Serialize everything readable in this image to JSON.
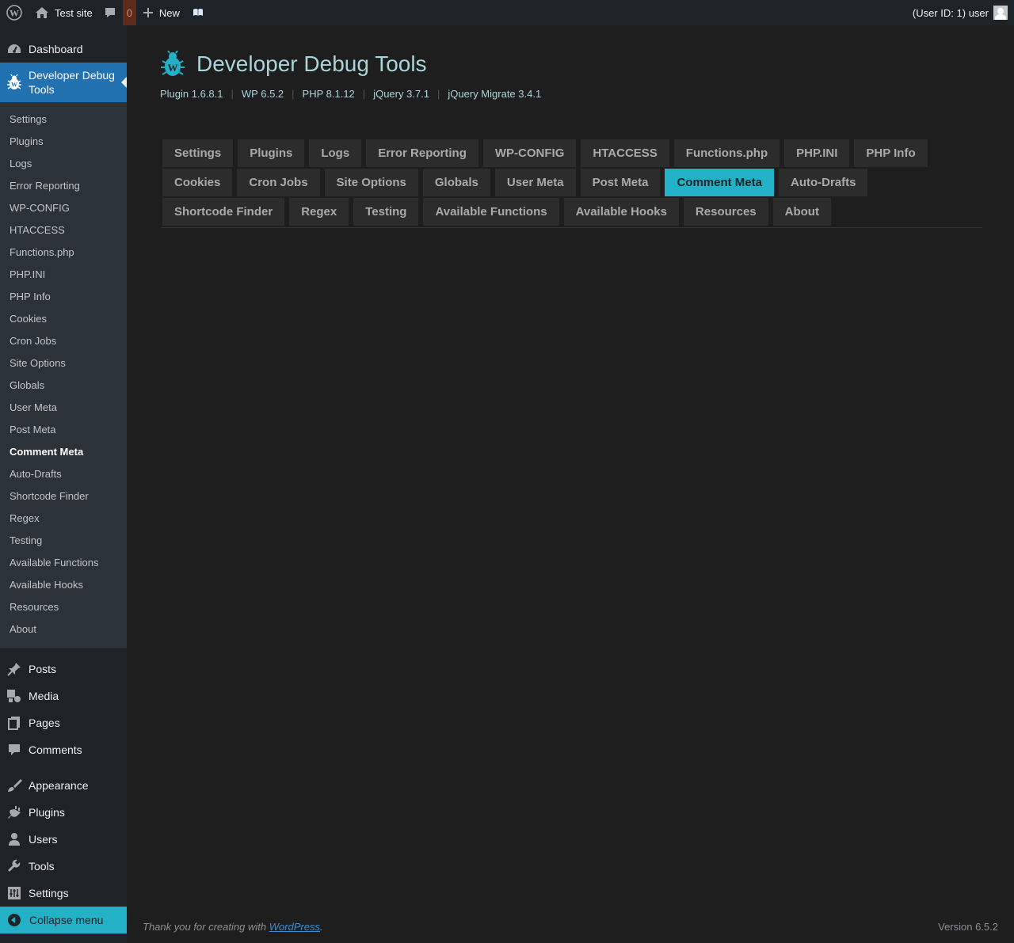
{
  "admin_bar": {
    "site_name": "Test site",
    "comment_count": "0",
    "new_label": "New",
    "user_label": "(User ID: 1) user"
  },
  "sidebar": {
    "top_before": [
      {
        "label": "Dashboard",
        "icon": "dashboard-icon"
      }
    ],
    "current": {
      "label": "Developer Debug Tools",
      "icon": "bug-icon"
    },
    "submenu": [
      "Settings",
      "Plugins",
      "Logs",
      "Error Reporting",
      "WP-CONFIG",
      "HTACCESS",
      "Functions.php",
      "PHP.INI",
      "PHP Info",
      "Cookies",
      "Cron Jobs",
      "Site Options",
      "Globals",
      "User Meta",
      "Post Meta",
      "Comment Meta",
      "Auto-Drafts",
      "Shortcode Finder",
      "Regex",
      "Testing",
      "Available Functions",
      "Available Hooks",
      "Resources",
      "About"
    ],
    "submenu_current_index": 15,
    "group_a": [
      {
        "label": "Posts",
        "icon": "pushpin-icon"
      },
      {
        "label": "Media",
        "icon": "media-icon"
      },
      {
        "label": "Pages",
        "icon": "pages-icon"
      },
      {
        "label": "Comments",
        "icon": "comment-icon"
      }
    ],
    "group_b": [
      {
        "label": "Appearance",
        "icon": "paintbrush-icon"
      },
      {
        "label": "Plugins",
        "icon": "plugin-icon"
      },
      {
        "label": "Users",
        "icon": "user-icon"
      },
      {
        "label": "Tools",
        "icon": "wrench-icon"
      },
      {
        "label": "Settings",
        "icon": "settings-icon"
      }
    ],
    "collapse_label": "Collapse menu"
  },
  "page": {
    "title": "Developer Debug Tools",
    "versions": [
      "Plugin 1.6.8.1",
      "WP 6.5.2",
      "PHP 8.1.12",
      "jQuery 3.7.1",
      "jQuery Migrate 3.4.1"
    ],
    "tabs": [
      "Settings",
      "Plugins",
      "Logs",
      "Error Reporting",
      "WP-CONFIG",
      "HTACCESS",
      "Functions.php",
      "PHP.INI",
      "PHP Info",
      "Cookies",
      "Cron Jobs",
      "Site Options",
      "Globals",
      "User Meta",
      "Post Meta",
      "Comment Meta",
      "Auto-Drafts",
      "Shortcode Finder",
      "Regex",
      "Testing",
      "Available Functions",
      "Available Hooks",
      "Resources",
      "About"
    ],
    "active_tab_index": 15
  },
  "footer": {
    "thanks_prefix": "Thank you for creating with ",
    "thanks_link": "WordPress",
    "thanks_suffix": ".",
    "version": "Version 6.5.2"
  },
  "colors": {
    "accent": "#22b1c7",
    "current_menu": "#2271b1",
    "background": "#1e1e1e"
  }
}
